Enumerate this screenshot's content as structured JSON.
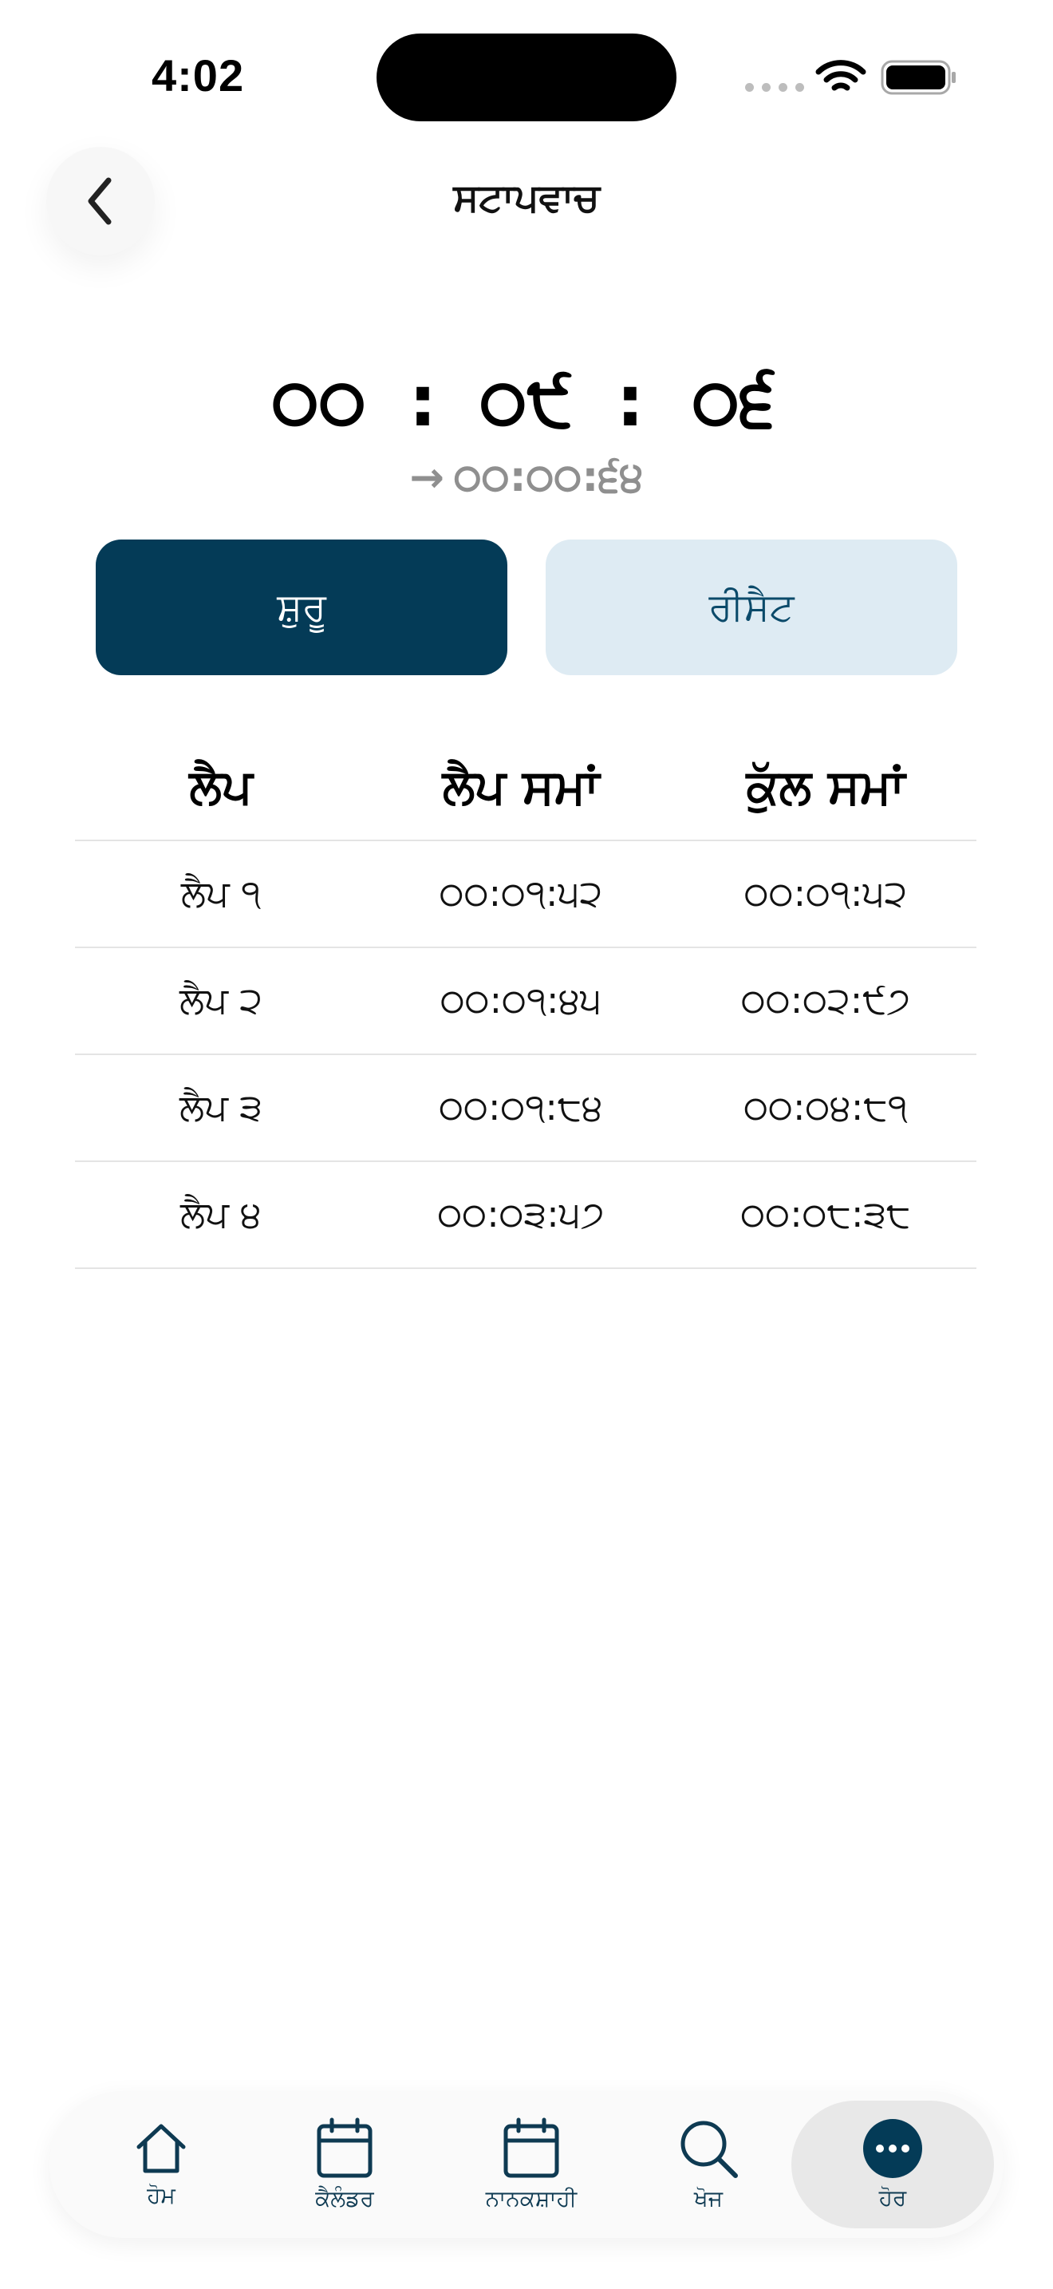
{
  "status_bar": {
    "time": "4:02"
  },
  "header": {
    "title": "ਸਟਾਪਵਾਚ"
  },
  "timer": {
    "h": "੦੦",
    "m": "੦੯",
    "s": "੦੬",
    "sep": ":",
    "elapsed_arrow": "→",
    "elapsed": "੦੦:੦੦:੬੪"
  },
  "buttons": {
    "start": "ਸ਼ੁਰੂ",
    "reset": "ਰੀਸੈਟ"
  },
  "table": {
    "headers": [
      "ਲੈਪ",
      "ਲੈਪ ਸਮਾਂ",
      "ਕੁੱਲ ਸਮਾਂ"
    ],
    "rows": [
      [
        "ਲੈਪ ੧",
        "੦੦:੦੧:੫੨",
        "੦੦:੦੧:੫੨"
      ],
      [
        "ਲੈਪ ੨",
        "੦੦:੦੧:੪੫",
        "੦੦:੦੨:੯੭"
      ],
      [
        "ਲੈਪ ੩",
        "੦੦:੦੧:੮੪",
        "੦੦:੦੪:੮੧"
      ],
      [
        "ਲੈਪ ੪",
        "੦੦:੦੩:੫੭",
        "੦੦:੦੮:੩੮"
      ]
    ]
  },
  "tabbar": {
    "items": [
      {
        "label": "ਹੋਮ",
        "icon": "home-icon"
      },
      {
        "label": "ਕੈਲੰਡਰ",
        "icon": "calendar-icon"
      },
      {
        "label": "ਨਾਨਕਸ਼ਾਹੀ",
        "icon": "calendar-icon"
      },
      {
        "label": "ਖੋਜ",
        "icon": "search-icon"
      },
      {
        "label": "ਹੋਰ",
        "icon": "more-icon"
      }
    ],
    "active_index": 4
  },
  "colors": {
    "primary": "#043b57",
    "secondary_bg": "#deebf3",
    "muted_text": "#8f8f8f"
  }
}
